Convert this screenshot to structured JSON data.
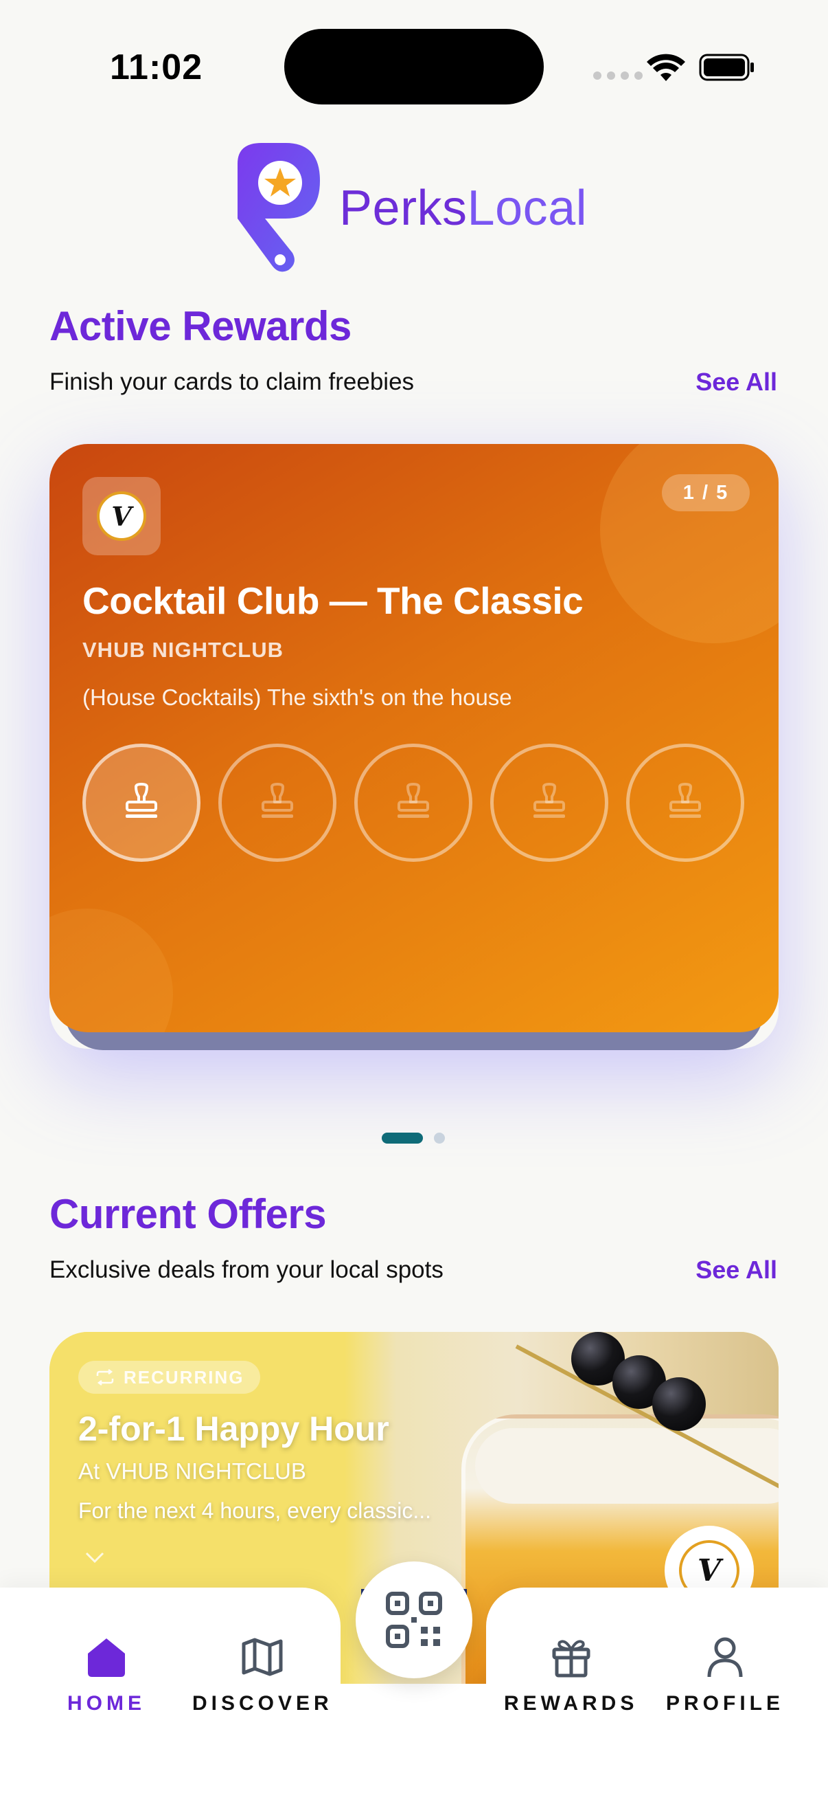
{
  "status_bar": {
    "time": "11:02"
  },
  "brand": {
    "name_part1": "Perks",
    "name_part2": "Local"
  },
  "active_rewards": {
    "title": "Active Rewards",
    "subtitle": "Finish your cards to claim freebies",
    "see_all": "See All",
    "card": {
      "merchant_logo_text": "V",
      "pager": "1 / 5",
      "title": "Cocktail Club — The Classic",
      "merchant": "VHUB NIGHTCLUB",
      "description": "(House Cocktails) The sixth's on the house",
      "stamps_total": 5,
      "stamps_collected": 1
    },
    "carousel_index": 1,
    "carousel_count": 2
  },
  "current_offers": {
    "title": "Current Offers",
    "subtitle": "Exclusive deals from your local spots",
    "see_all": "See All",
    "offer": {
      "badge": "RECURRING",
      "title": "2-for-1 Happy Hour",
      "merchant": "At VHUB NIGHTCLUB",
      "description": "For the next 4 hours, every classic...",
      "merchant_logo_text": "V"
    }
  },
  "bottom_nav": {
    "items": [
      {
        "label": "HOME",
        "icon": "home-icon",
        "active": true
      },
      {
        "label": "DISCOVER",
        "icon": "map-icon",
        "active": false
      },
      {
        "label": "REWARDS",
        "icon": "gift-icon",
        "active": false
      },
      {
        "label": "PROFILE",
        "icon": "user-icon",
        "active": false
      }
    ],
    "center_action_icon": "qr-code-icon"
  },
  "colors": {
    "accent": "#6d28d9",
    "background": "#f8f8f5",
    "card_gradient_start": "#c9470f",
    "card_gradient_end": "#f39a12",
    "carousel_active": "#0f6b78"
  }
}
